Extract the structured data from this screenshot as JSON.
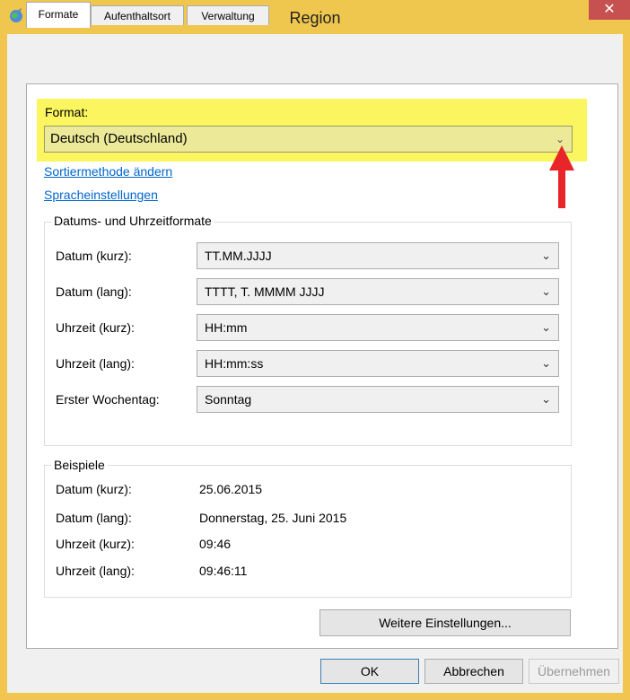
{
  "window": {
    "title": "Region",
    "close_glyph": "✕",
    "app_icon": "globe-icon"
  },
  "tabs": [
    {
      "label": "Formate",
      "active": true
    },
    {
      "label": "Aufenthaltsort",
      "active": false
    },
    {
      "label": "Verwaltung",
      "active": false
    }
  ],
  "format": {
    "label": "Format:",
    "value": "Deutsch (Deutschland)",
    "chevron": "⌄"
  },
  "links": {
    "sort": "Sortiermethode ändern",
    "language": "Spracheinstellungen"
  },
  "datetime_group": {
    "title": "Datums- und Uhrzeitformate",
    "rows": [
      {
        "label": "Datum (kurz):",
        "value": "TT.MM.JJJJ"
      },
      {
        "label": "Datum (lang):",
        "value": "TTTT, T. MMMM JJJJ"
      },
      {
        "label": "Uhrzeit (kurz):",
        "value": "HH:mm"
      },
      {
        "label": "Uhrzeit (lang):",
        "value": "HH:mm:ss"
      },
      {
        "label": "Erster Wochentag:",
        "value": "Sonntag"
      }
    ]
  },
  "examples_group": {
    "title": "Beispiele",
    "rows": [
      {
        "label": "Datum (kurz):",
        "value": "25.06.2015"
      },
      {
        "label": "Datum (lang):",
        "value": "Donnerstag, 25. Juni 2015"
      },
      {
        "label": "Uhrzeit (kurz):",
        "value": "09:46"
      },
      {
        "label": "Uhrzeit (lang):",
        "value": "09:46:11"
      }
    ]
  },
  "buttons": {
    "more_settings": "Weitere Einstellungen...",
    "ok": "OK",
    "cancel": "Abbrechen",
    "apply": "Übernehmen"
  },
  "colors": {
    "frame": "#f0c74e",
    "highlight": "#fbf55f",
    "arrow": "#e8262a",
    "link": "#0066cc",
    "close": "#c75050"
  }
}
